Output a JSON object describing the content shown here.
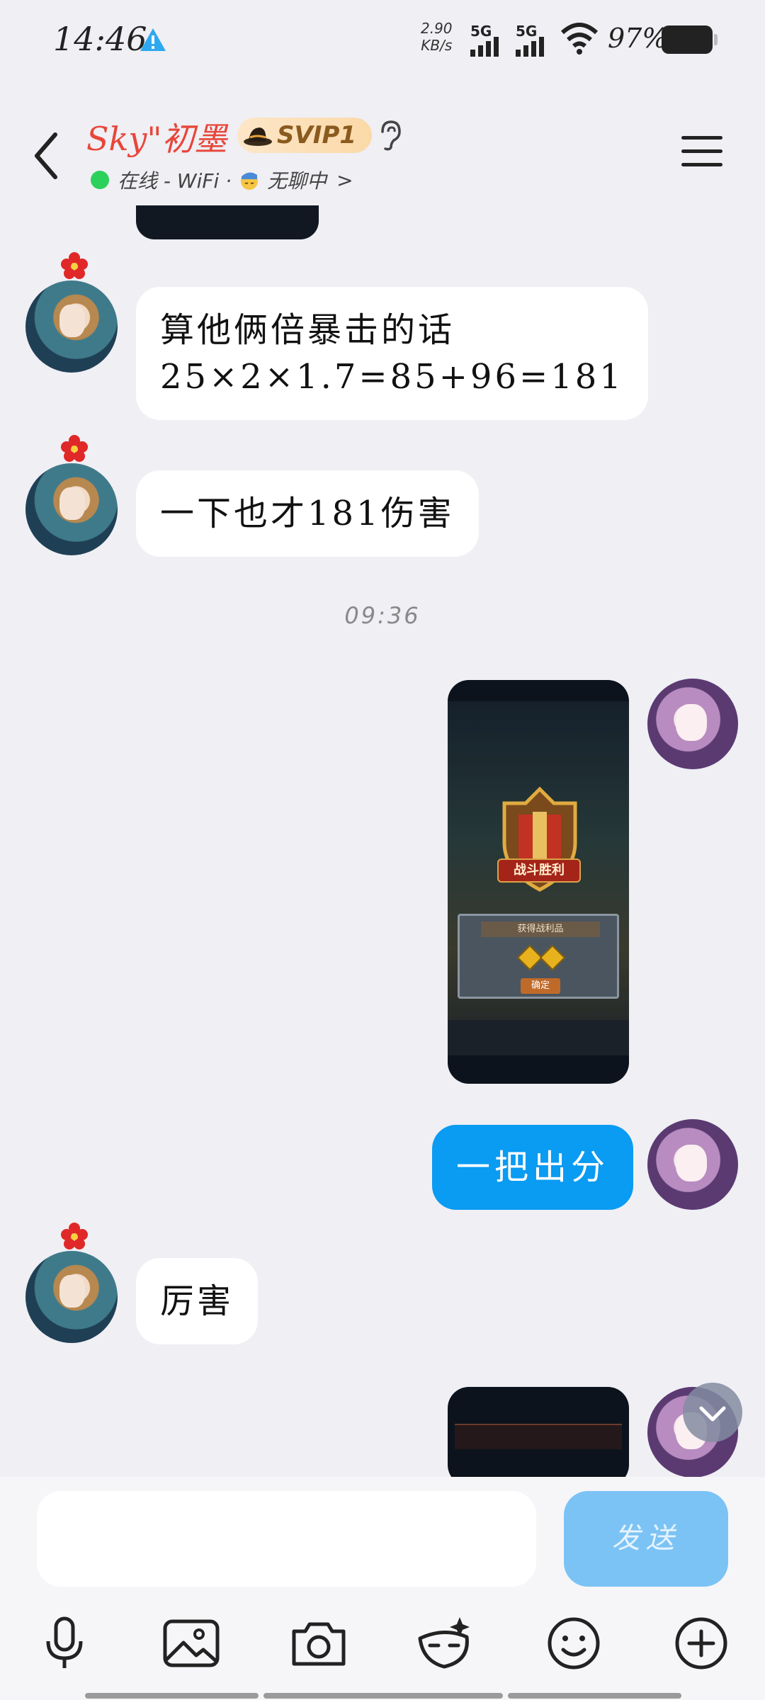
{
  "status_bar": {
    "time": "14:46",
    "net_speed": "2.90",
    "net_speed_unit": "KB/s",
    "signal1": "5G",
    "signal2": "5G",
    "battery": "97%"
  },
  "header": {
    "contact_name": "Sky\"初墨",
    "vip_badge": "SVIP1",
    "status_text": "在线 - WiFi ·",
    "mood_text": "无聊中",
    "mood_arrow": ">"
  },
  "messages": [
    {
      "side": "left",
      "text": "算他俩倍暴击的话\n25×2×1.7=85+96=181"
    },
    {
      "side": "left",
      "text": "一下也才181伤害"
    },
    {
      "side": "right",
      "text": "一把出分"
    },
    {
      "side": "left",
      "text": "厉害"
    }
  ],
  "timestamp": "09:36",
  "game_image": {
    "victory": "战斗胜利",
    "rewards": "获得战利品",
    "confirm": "确定"
  },
  "input": {
    "placeholder": "",
    "send_label": "发送"
  },
  "toolbar": [
    "microphone-icon",
    "image-icon",
    "camera-icon",
    "mask-icon",
    "emoji-icon",
    "plus-icon"
  ]
}
